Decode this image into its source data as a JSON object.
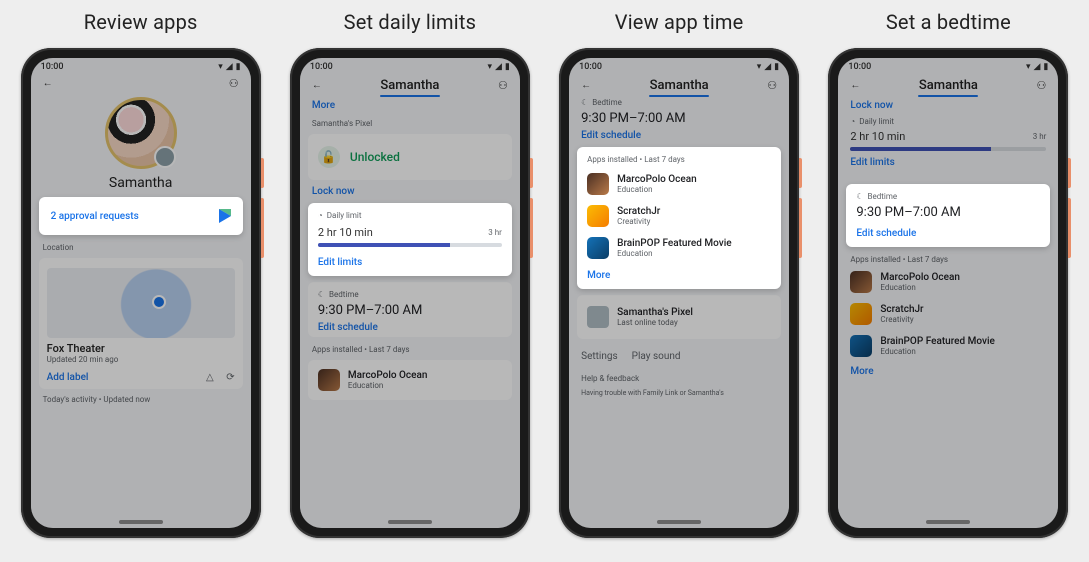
{
  "titles": {
    "c1": "Review apps",
    "c2": "Set daily limits",
    "c3": "View app time",
    "c4": "Set a bedtime"
  },
  "status_time": "10:00",
  "child_name": "Samantha",
  "screen1": {
    "approval": "2 approval requests",
    "location_section": "Location",
    "loc_name": "Fox Theater",
    "loc_updated": "Updated 20 min ago",
    "add_label": "Add label",
    "footer": "Today's activity • Updated now"
  },
  "screen2": {
    "more": "More",
    "device": "Samantha's Pixel",
    "unlocked": "Unlocked",
    "lock_now": "Lock now",
    "daily_limit_label": "Daily limit",
    "limit_value": "2 hr 10 min",
    "limit_max": "3 hr",
    "edit_limits": "Edit limits",
    "bedtime_label": "Bedtime",
    "bedtime_value": "9:30 PM–7:00 AM",
    "edit_schedule": "Edit schedule",
    "apps_label": "Apps installed • Last 7 days",
    "app1_name": "MarcoPolo Ocean",
    "app1_cat": "Education"
  },
  "screen3": {
    "bedtime_label": "Bedtime",
    "bedtime_value": "9:30 PM–7:00 AM",
    "edit_schedule": "Edit schedule",
    "apps_label": "Apps installed • Last 7 days",
    "app1_name": "MarcoPolo Ocean",
    "app1_cat": "Education",
    "app2_name": "ScratchJr",
    "app2_cat": "Creativity",
    "app3_name": "BrainPOP Featured Movie",
    "app3_cat": "Education",
    "more": "More",
    "device": "Samantha's Pixel",
    "last_online": "Last online today",
    "settings": "Settings",
    "play_sound": "Play sound",
    "help": "Help & feedback",
    "trouble": "Having trouble with Family Link or Samantha's"
  },
  "screen4": {
    "lock_now": "Lock now",
    "daily_limit_label": "Daily limit",
    "limit_value": "2 hr 10 min",
    "limit_max": "3 hr",
    "edit_limits": "Edit limits",
    "bedtime_label": "Bedtime",
    "bedtime_value": "9:30 PM–7:00 AM",
    "edit_schedule": "Edit schedule",
    "apps_label": "Apps installed • Last 7 days",
    "app1_name": "MarcoPolo Ocean",
    "app1_cat": "Education",
    "app2_name": "ScratchJr",
    "app2_cat": "Creativity",
    "app3_name": "BrainPOP Featured Movie",
    "app3_cat": "Education",
    "more": "More"
  }
}
